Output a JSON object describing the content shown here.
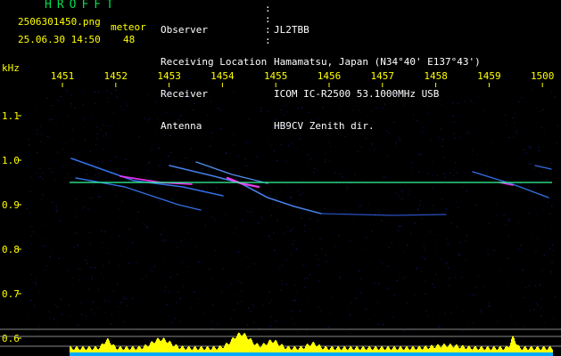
{
  "header": {
    "brand": "HROFFT",
    "filename": "2506301450.png",
    "datetime": "25.06.30 14:50",
    "meteor_label": "meteor",
    "meteor_count": "48"
  },
  "station_info": [
    {
      "key": "Observer",
      "value": "JL2TBB"
    },
    {
      "key": "Receiving Location",
      "value": "Hamamatsu, Japan (N34°40' E137°43')"
    },
    {
      "key": "Receiver",
      "value": "ICOM IC-R2500 53.1000MHz USB"
    },
    {
      "key": "Antenna",
      "value": "HB9CV Zenith dir."
    }
  ],
  "chart_data": {
    "type": "heatmap",
    "ylabel": "kHz",
    "x_ticks": [
      "1451",
      "1452",
      "1453",
      "1454",
      "1455",
      "1456",
      "1457",
      "1458",
      "1459",
      "1500"
    ],
    "y_ticks": [
      "1.1",
      "1.0",
      "0.9",
      "0.8",
      "0.7",
      "0.6"
    ],
    "ylim": [
      0.58,
      1.18
    ],
    "carrier_line_khz": 0.95,
    "colors": {
      "tick_labels": "#ffff00",
      "carrier_line": "#33ff99",
      "activity_bars": "#ffff00",
      "baseline": "#00aaff"
    }
  }
}
